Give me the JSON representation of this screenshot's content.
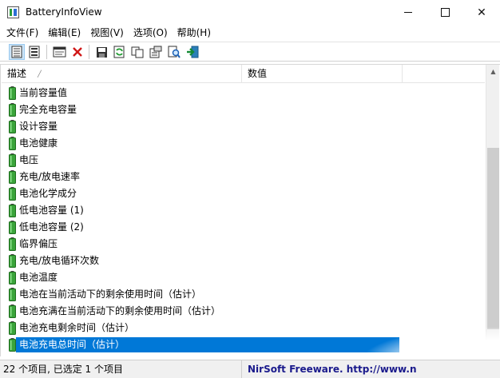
{
  "window": {
    "title": "BatteryInfoView",
    "minimize_glyph": "—",
    "close_glyph": "✕"
  },
  "menu": {
    "items": [
      {
        "label": "文件(F)"
      },
      {
        "label": "编辑(E)"
      },
      {
        "label": "视图(V)"
      },
      {
        "label": "选项(O)"
      },
      {
        "label": "帮助(H)"
      }
    ]
  },
  "toolbar": {
    "icons": [
      "battery-info-mode-icon",
      "battery-log-mode-icon",
      "html-report-icon",
      "delete-icon",
      "save-icon",
      "refresh-icon",
      "copy-icon",
      "properties-icon",
      "find-icon",
      "exit-icon"
    ]
  },
  "list": {
    "columns": [
      {
        "label": "描述",
        "sort_arrow": "╱"
      },
      {
        "label": "数值"
      },
      {
        "label": ""
      }
    ],
    "rows": [
      {
        "label": "当前容量值"
      },
      {
        "label": "完全充电容量"
      },
      {
        "label": "设计容量"
      },
      {
        "label": "电池健康"
      },
      {
        "label": "电压"
      },
      {
        "label": "充电/放电速率"
      },
      {
        "label": "电池化学成分"
      },
      {
        "label": "低电池容量 (1)"
      },
      {
        "label": "低电池容量 (2)"
      },
      {
        "label": "临界偏压"
      },
      {
        "label": "充电/放电循环次数"
      },
      {
        "label": "电池温度"
      },
      {
        "label": "电池在当前活动下的剩余使用时间（估计）"
      },
      {
        "label": "电池充满在当前活动下的剩余使用时间（估计）"
      },
      {
        "label": "电池充电剩余时间（估计）"
      },
      {
        "label": "电池充电总时间（估计）",
        "selected": true
      }
    ]
  },
  "scrollbar": {
    "up_arrow": "▲",
    "down_arrow": "▼"
  },
  "status": {
    "left": "22 个项目, 已选定 1 个项目",
    "right_brand": "NirSoft Freeware.",
    "right_link": "http://www.n"
  },
  "colors": {
    "selection": "#0078d7",
    "battery_green": "#3aa43a",
    "status_link": "#1a1a8c"
  }
}
